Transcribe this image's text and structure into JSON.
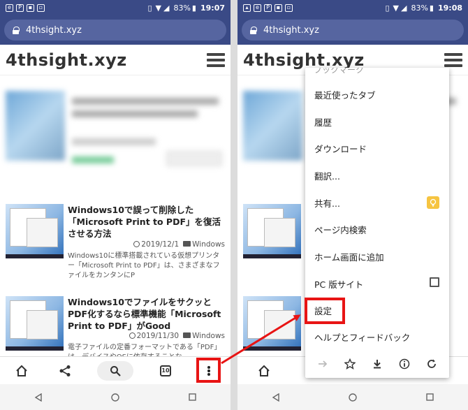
{
  "status_left": {
    "battery": "83%",
    "time": "19:07"
  },
  "status_right": {
    "battery": "83%",
    "time": "19:08"
  },
  "url": "4thsight.xyz",
  "logo": "4thsight.xyz",
  "articles": [
    {
      "title": "Windows10で誤って削除した「Microsoft Print to PDF」を復活させる方法",
      "date": "2019/12/1",
      "category": "Windows",
      "excerpt": "Windows10に標準搭載されている仮想プリンター「Microsoft Print to PDF」は、さまざまなファイルをカンタンにP"
    },
    {
      "title": "Windows10でファイルをサクッとPDF化するなら標準機能「Microsoft Print to PDF」がGood",
      "date": "2019/11/30",
      "category": "Windows",
      "excerpt": "電子ファイルの定番フォーマットである「PDF」は、デバイスやOSに依存することな"
    }
  ],
  "toolbar": {
    "tab_count": "10"
  },
  "menu": {
    "truncated_top": "ブックマーク",
    "items": [
      {
        "label": "最近使ったタブ"
      },
      {
        "label": "履歴"
      },
      {
        "label": "ダウンロード"
      },
      {
        "label": "翻訳..."
      },
      {
        "label": "共有..."
      },
      {
        "label": "ページ内検索"
      },
      {
        "label": "ホーム画面に追加"
      },
      {
        "label": "PC 版サイト"
      },
      {
        "label": "設定"
      },
      {
        "label": "ヘルプとフィードバック"
      }
    ]
  },
  "colors": {
    "chrome_bar": "#3a4a86",
    "highlight": "#e81414",
    "bulb": "#f6c441"
  }
}
